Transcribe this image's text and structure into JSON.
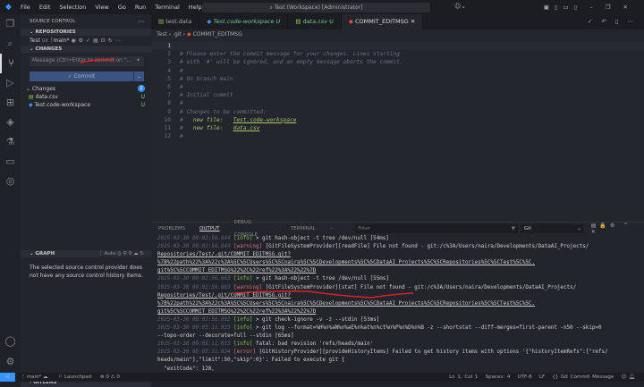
{
  "titlebar": {
    "menus": [
      "File",
      "Edit",
      "Selection",
      "View",
      "Go",
      "Run",
      "Terminal",
      "Help"
    ],
    "search": "Test (Workspace) [Administrator]"
  },
  "sidebar": {
    "title": "SOURCE CONTROL",
    "repositories_header": "REPOSITORIES",
    "repo_name": "Test",
    "repo_type": "Git",
    "branch": "main*",
    "changes_header": "CHANGES",
    "message_placeholder": "Message (Ctrl+Enter to commit on \"...",
    "commit_label": "✓ Commit",
    "changes_group": "Changes",
    "changes_count": "2",
    "files": [
      {
        "name": "data.csv",
        "status": "U"
      },
      {
        "name": "Test.code-workspace",
        "status": "U"
      }
    ],
    "graph_header": "GRAPH",
    "graph_auto": "Auto",
    "graph_empty": "The selected source control provider does not have any source control history items.",
    "gitlens_header": "GITLENS"
  },
  "tabs": [
    {
      "label": "test.data"
    },
    {
      "label": "Test.code-workspace",
      "badge": "U"
    },
    {
      "label": "data.csv",
      "badge": "U"
    },
    {
      "label": "COMMIT_EDITMSG"
    }
  ],
  "breadcrumb": [
    "Test",
    ".git",
    "COMMIT_EDITMSG"
  ],
  "editor_lines": [
    "",
    "# Please enter the commit message for your changes. Lines starting",
    "# with '#' will be ignored, and an empty message aborts the commit.",
    "#",
    "# On branch main",
    "#",
    "# Initial commit",
    "#",
    "# Changes to be committed:",
    "#\tnew file:   Test.code-workspace",
    "#\tnew file:   data.csv",
    "#"
  ],
  "panel": {
    "tabs": [
      "PROBLEMS",
      "OUTPUT",
      "DEBUG CONSOLE",
      "TERMINAL"
    ],
    "active_tab": "OUTPUT",
    "filter_placeholder": "Filter",
    "channel": "Git",
    "lines": [
      {
        "ts": "2025-03-30 09:02:56.644",
        "lvl": "[info]",
        "text": " > git hash-object -t tree /dev/null [54ms]"
      },
      {
        "ts": "2025-03-30 09:02:56.644",
        "lvl": "[warning]",
        "text": " [GitFileSystemProvider][readFile] File not found - git:/c%3A/Users/naira/Developments/DataAI_Projects/"
      },
      {
        "ts": "",
        "lvl": "",
        "text": "Repositories/Test/.git/COMMIT_EDITMSG.git?"
      },
      {
        "ts": "",
        "lvl": "",
        "text": "%7B%22path%22%3A%22c%3A%5C%5CUsers%5C%5Cnaira%5C%5CDevelopments%5C%5CDataAI_Projects%5C%5CRepositories%5C%5CTest%5C%5C."
      },
      {
        "ts": "",
        "lvl": "",
        "text": "git%5C%5CCOMMIT_EDITMSG%22%2C%22ref%22%3A%22%22%7D"
      },
      {
        "ts": "2025-03-30 09:02:56.663",
        "lvl": "[info]",
        "text": " > git hash-object -t tree /dev/null [55ms]"
      },
      {
        "ts": "2025-03-30 09:02:56.663",
        "lvl": "[warning]",
        "text": " [GitFileSystemProvider][stat] File not found - git:/c%3A/Users/naira/Developments/DataAI_Projects/"
      },
      {
        "ts": "",
        "lvl": "",
        "text": "Repositories/Test/.git/COMMIT_EDITMSG.git?"
      },
      {
        "ts": "",
        "lvl": "",
        "text": "%7B%22path%22%3A%22c%3A%5C%5CUsers%5C%5Cnaira%5C%5CDevelopments%5C%5CDataAI_Projects%5C%5CRepositories%5C%5CTest%5C%5C."
      },
      {
        "ts": "",
        "lvl": "",
        "text": "git%5C%5CCOMMIT_EDITMSG%22%2C%22ref%22%3A%22%22%7D"
      },
      {
        "ts": "2025-03-30 09:02:56.892",
        "lvl": "[info]",
        "text": " > git check-ignore -v -z --stdin [53ms]"
      },
      {
        "ts": "2025-03-30 09:05:11.033",
        "lvl": "[info]",
        "text": " > git log --format=%H%n%aN%n%aE%n%at%n%ct%n%P%n%D%n%B -z --shortstat --diff-merges=first-parent -n50 --skip=0"
      },
      {
        "ts": "",
        "lvl": "",
        "text": "--topo-order --decorate=full --stdin [65ms]"
      },
      {
        "ts": "2025-03-30 09:05:11.033",
        "lvl": "[info]",
        "text": " fatal: bad revision 'refs/heads/main'"
      },
      {
        "ts": "2025-03-30 09:05:11.034",
        "lvl": "[error]",
        "text": " [GitHistoryProvider][provideHistoryItems] Failed to get history items with options '{\"historyItemRefs\":[\"refs/"
      },
      {
        "ts": "",
        "lvl": "",
        "text": "heads/main\"],\"limit\":50,\"skip\":0}': Failed to execute git {"
      },
      {
        "ts": "",
        "lvl": "",
        "text": "  \"exitCode\": 128,"
      }
    ]
  },
  "status": {
    "branch": "main*",
    "launchpad": "Launchpad",
    "errors": "0",
    "warnings": "0",
    "position": "Ln 1, Col 1",
    "spaces": "Spaces: 4",
    "encoding": "UTF-8",
    "eol": "LF",
    "language": "Git Commit Message"
  },
  "colors": {
    "accent": "#3794ff",
    "annotation": "#e02020",
    "untracked": "#73c991"
  }
}
